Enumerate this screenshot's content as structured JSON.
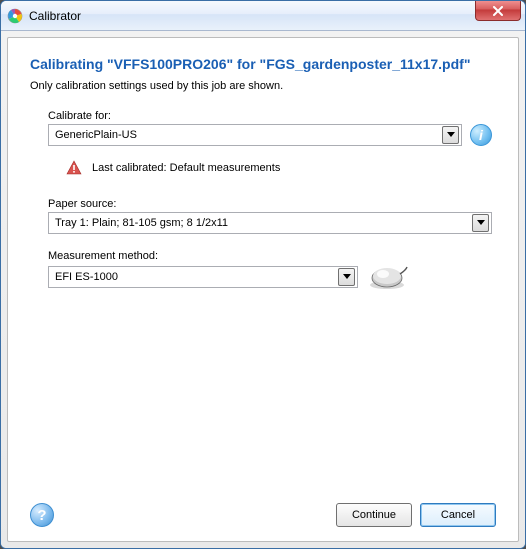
{
  "window": {
    "title": "Calibrator"
  },
  "heading": "Calibrating \"VFFS100PRO206\" for \"FGS_gardenposter_11x17.pdf\"",
  "subtext": "Only calibration settings used by this job are shown.",
  "calibrate_for": {
    "label": "Calibrate for:",
    "value": "GenericPlain-US"
  },
  "warning": {
    "text": "Last calibrated: Default measurements"
  },
  "paper_source": {
    "label": "Paper source:",
    "value": "Tray 1: Plain; 81-105 gsm; 8 1/2x11"
  },
  "measurement_method": {
    "label": "Measurement method:",
    "value": "EFI ES-1000"
  },
  "buttons": {
    "continue": "Continue",
    "cancel": "Cancel"
  },
  "icons": {
    "info": "i",
    "help": "?"
  }
}
